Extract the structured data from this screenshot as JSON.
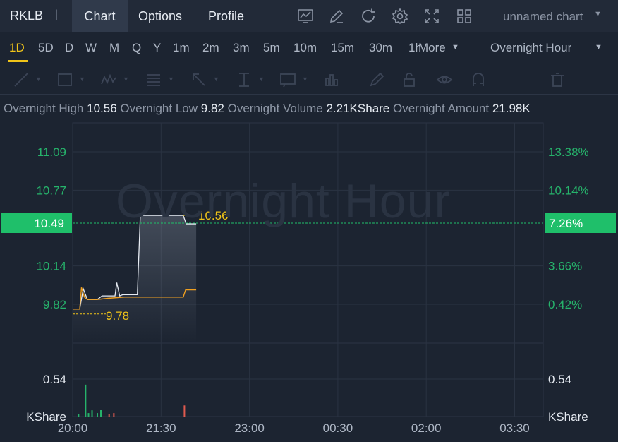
{
  "header": {
    "ticker": "RKLB",
    "separator": "|",
    "tabs": [
      {
        "label": "Chart",
        "active": true
      },
      {
        "label": "Options",
        "active": false
      },
      {
        "label": "Profile",
        "active": false
      }
    ],
    "tools": [
      "chart-type-icon",
      "draw-pen-icon",
      "refresh-icon",
      "gear-icon",
      "fullscreen-icon",
      "layout-grid-icon"
    ],
    "chart_name": "unnamed chart"
  },
  "periods": {
    "items": [
      "1D",
      "5D",
      "D",
      "W",
      "M",
      "Q",
      "Y",
      "1m",
      "2m",
      "3m",
      "5m",
      "10m",
      "15m",
      "30m",
      "1h"
    ],
    "active": "1D",
    "more_label": "More",
    "session": "Overnight Hour"
  },
  "drawing_tools": [
    "trend-line-icon",
    "rectangle-icon",
    "pattern-icon",
    "fib-icon",
    "arrow-icon",
    "text-cursor-icon",
    "annotation-icon",
    "indicator-icon",
    "brush-icon",
    "lock-icon",
    "eye-icon",
    "magnet-icon",
    "trash-icon"
  ],
  "stats": {
    "high_label": "Overnight High",
    "high_value": "10.56",
    "low_label": "Overnight Low",
    "low_value": "9.82",
    "volume_label": "Overnight Volume",
    "volume_value": "2.21KShare",
    "amount_label": "Overnight Amount",
    "amount_value": "21.98K"
  },
  "watermark": "Overnight Hour",
  "colors": {
    "up": "#26b36b",
    "down": "#e05a4f",
    "avg_line": "#f0a020",
    "price_line": "#e6ebf2",
    "accent": "#f0c419",
    "current_price_bg": "#1fbf6a"
  },
  "chart_data": {
    "type": "line",
    "y_left_ticks": [
      "11.09",
      "10.77",
      "10.14",
      "9.82"
    ],
    "y_right_ticks": [
      "13.38%",
      "10.14%",
      "3.66%",
      "0.42%"
    ],
    "current_price": "10.49",
    "current_pct": "7.26%",
    "high_marker": "10.56",
    "low_marker": "9.78",
    "volume_tick": "0.54",
    "volume_unit": "KShare",
    "x_ticks": [
      "20:00",
      "21:30",
      "23:00",
      "00:30",
      "02:00",
      "03:30"
    ],
    "ylim": [
      9.7,
      11.2
    ],
    "price": {
      "x": [
        20.0,
        20.12,
        20.18,
        20.25,
        20.42,
        20.5,
        20.72,
        20.75,
        20.8,
        20.85,
        20.88,
        21.1,
        21.15,
        21.18,
        21.2,
        21.88,
        21.93,
        21.97,
        22.1
      ],
      "y": [
        9.78,
        9.78,
        9.95,
        9.86,
        9.86,
        9.89,
        9.89,
        10.0,
        9.89,
        9.9,
        9.9,
        9.9,
        10.56,
        10.56,
        10.56,
        10.56,
        10.49,
        10.49,
        10.49
      ]
    },
    "avg": {
      "x": [
        20.0,
        20.12,
        20.15,
        20.2,
        20.25,
        20.42,
        20.6,
        20.88,
        21.2,
        21.88,
        21.92,
        22.1
      ],
      "y": [
        9.78,
        9.78,
        9.96,
        9.88,
        9.86,
        9.86,
        9.87,
        9.88,
        9.88,
        9.88,
        9.94,
        9.94
      ]
    },
    "volume": {
      "x": [
        20.1,
        20.22,
        20.27,
        20.33,
        20.42,
        20.48,
        20.62,
        20.7,
        21.9
      ],
      "v": [
        0.04,
        0.46,
        0.05,
        0.09,
        0.05,
        0.1,
        0.04,
        0.05,
        0.16
      ],
      "dir": [
        "up",
        "up",
        "up",
        "up",
        "up",
        "up",
        "down",
        "down",
        "down"
      ],
      "vlim": [
        0,
        0.54
      ]
    },
    "xlim": [
      20.0,
      28.0
    ]
  }
}
